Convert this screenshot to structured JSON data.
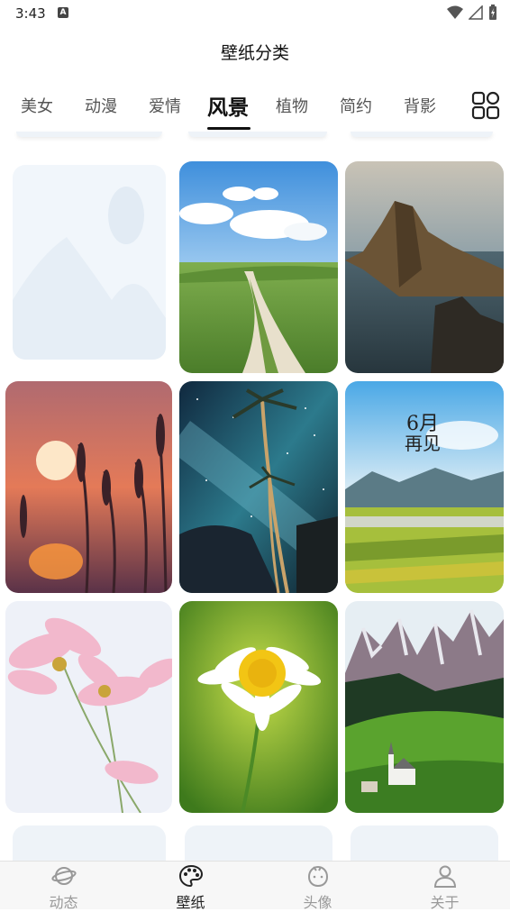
{
  "status_bar": {
    "time": "3:43",
    "notification_badge": "A",
    "icons": [
      "wifi-icon",
      "signal-icon",
      "battery-charging-icon"
    ]
  },
  "header": {
    "title": "壁纸分类"
  },
  "tabs": [
    {
      "label": "美女",
      "active": false
    },
    {
      "label": "动漫",
      "active": false
    },
    {
      "label": "爱情",
      "active": false
    },
    {
      "label": "风景",
      "active": true
    },
    {
      "label": "植物",
      "active": false
    },
    {
      "label": "简约",
      "active": false
    },
    {
      "label": "背影",
      "active": false
    }
  ],
  "tabs_menu_icon": "grid-icon",
  "wallpapers": [
    {
      "name": "loading-placeholder",
      "icon": "image-placeholder-icon"
    },
    {
      "name": "country-road-under-blue-sky"
    },
    {
      "name": "sea-cliff-at-dusk"
    },
    {
      "name": "sunset-reeds"
    },
    {
      "name": "palm-trees-milky-way"
    },
    {
      "name": "june-goodbye-village",
      "overlay_text": [
        "6月",
        "再见"
      ]
    },
    {
      "name": "pink-cosmos-flowers"
    },
    {
      "name": "white-daisy"
    },
    {
      "name": "dolomites-alpine-church"
    }
  ],
  "bottom_nav": [
    {
      "label": "动态",
      "icon": "planet-icon",
      "active": false
    },
    {
      "label": "壁纸",
      "icon": "palette-icon",
      "active": true
    },
    {
      "label": "头像",
      "icon": "avatar-face-icon",
      "active": false
    },
    {
      "label": "关于",
      "icon": "person-icon",
      "active": false
    }
  ],
  "colors": {
    "active_text": "#111111",
    "inactive_text": "#555555",
    "nav_inactive": "#999999",
    "placeholder_bg": "#f1f6fb"
  }
}
